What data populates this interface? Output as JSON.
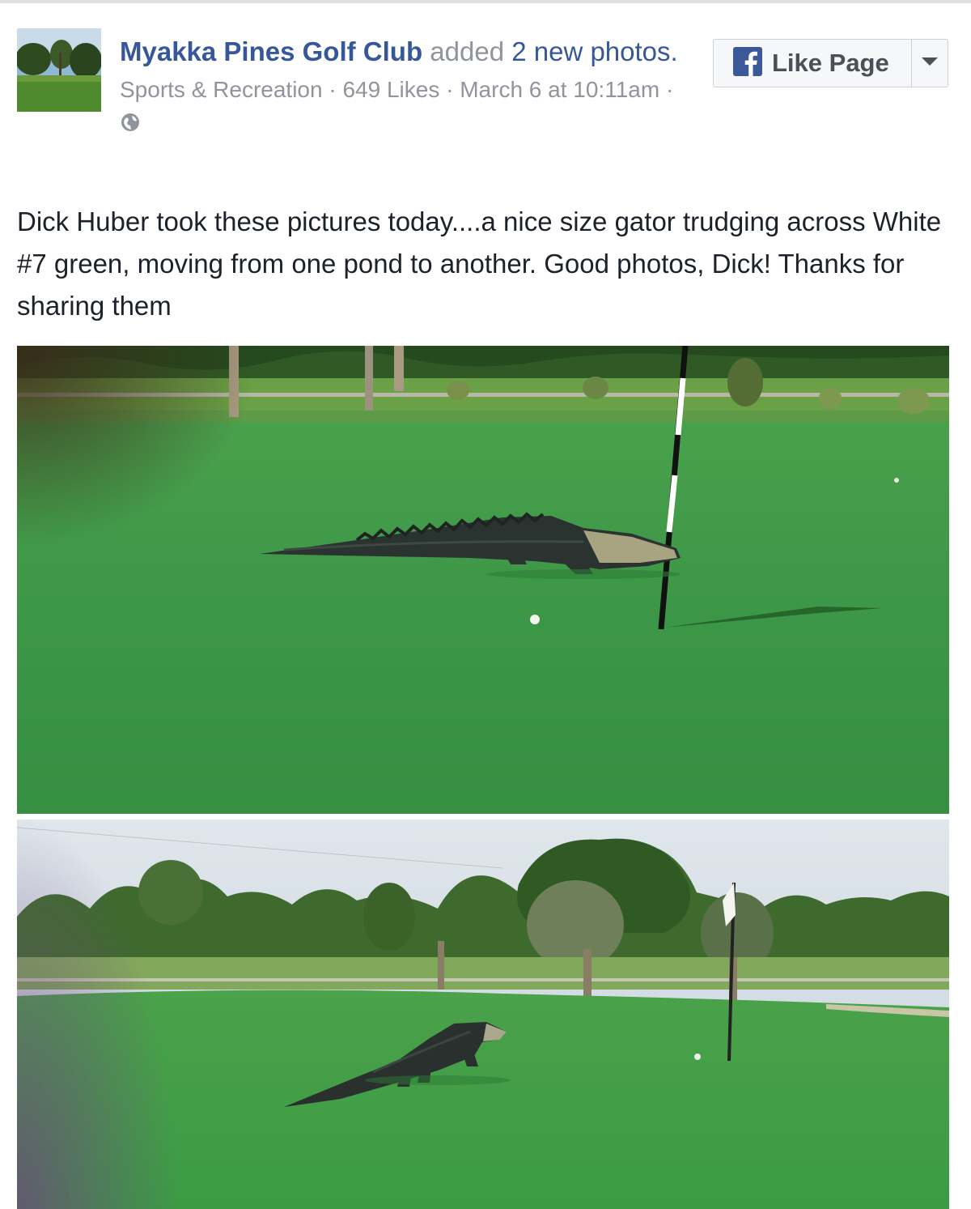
{
  "post": {
    "page_name": "Myakka Pines Golf Club",
    "action_pre": " added ",
    "action_link": "2 new photos.",
    "category": "Sports & Recreation",
    "likes": "649 Likes",
    "separator": " · ",
    "date": "March 6 at 10:11am",
    "privacy_icon": "globe-icon",
    "body": "Dick Huber took these pictures today....a nice size gator trudging across White #7 green, moving from one pond to another. Good photos, Dick! Thanks for sharing them"
  },
  "like_button": {
    "label": "Like Page",
    "icon": "facebook-f-icon",
    "dropdown_icon": "caret-down-icon"
  },
  "colors": {
    "link": "#365899",
    "meta": "#90949c",
    "text": "#1d2129",
    "facebook_blue": "#3b5998",
    "green": "#3f9a47"
  },
  "photos": [
    {
      "subject": "alligator lying on putting green beside flagstick"
    },
    {
      "subject": "alligator walking across putting green toward flag"
    }
  ]
}
